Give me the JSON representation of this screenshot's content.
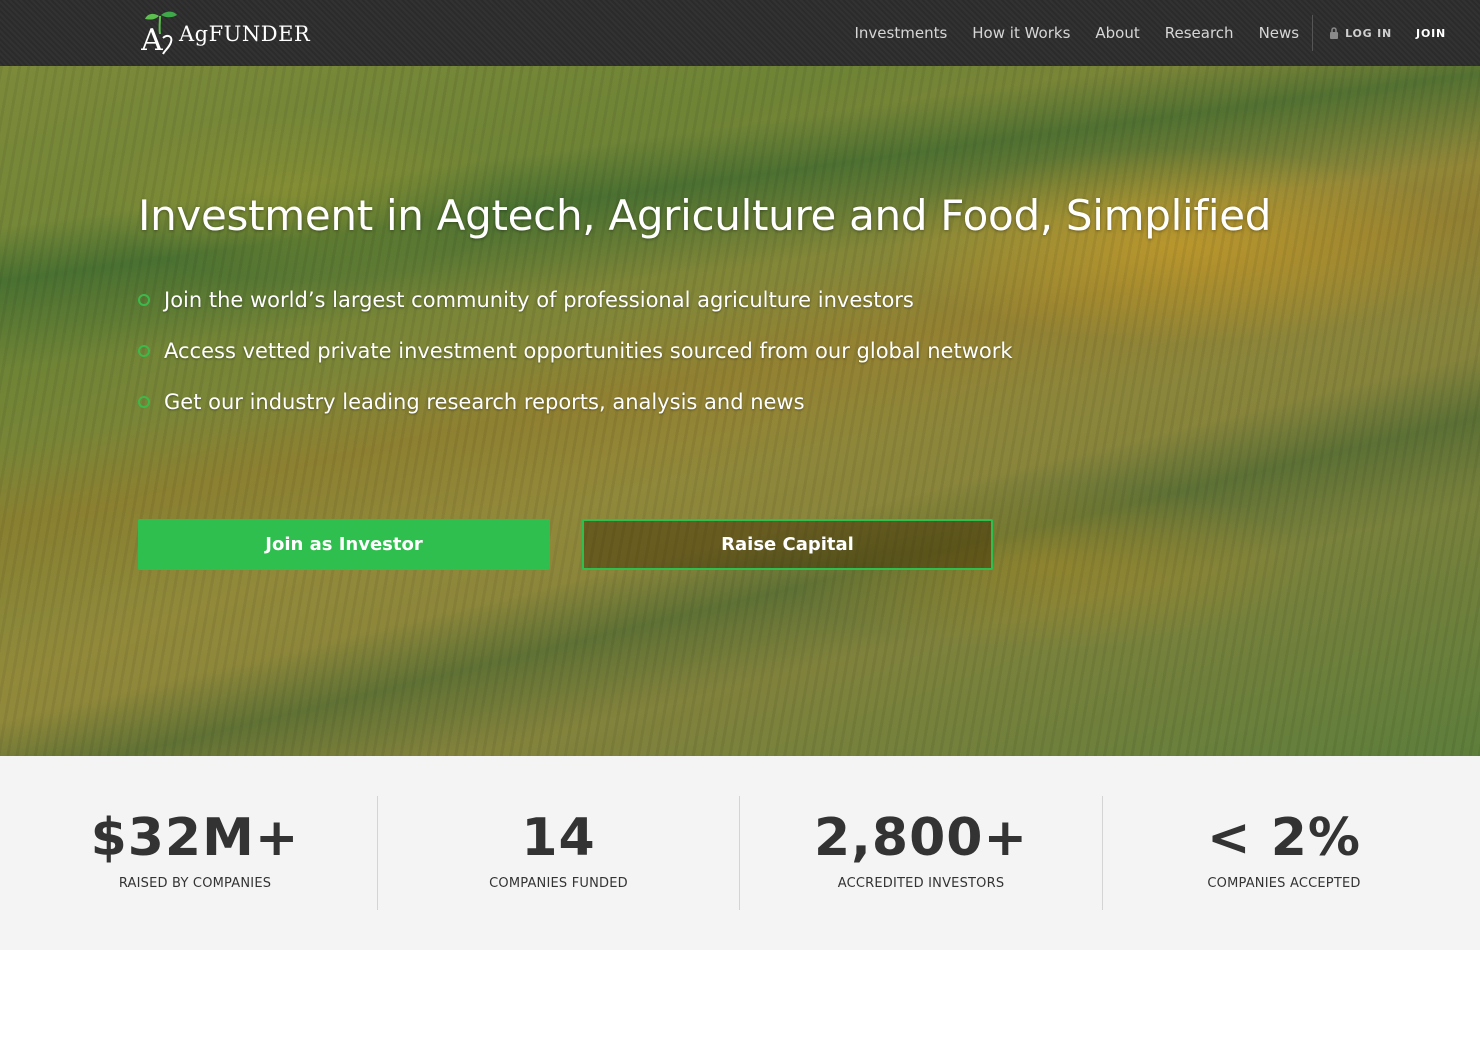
{
  "brand": {
    "logo_text": "AgFUNDER"
  },
  "nav": {
    "links": [
      "Investments",
      "How it Works",
      "About",
      "Research",
      "News"
    ],
    "login": "LOG IN",
    "join": "JOIN"
  },
  "hero": {
    "headline": "Investment in Agtech, Agriculture and Food, Simplified",
    "bullets": [
      "Join the world’s largest community of professional agriculture investors",
      "Access vetted private investment opportunities sourced from our global network",
      "Get our industry leading research reports, analysis and news"
    ],
    "buttons": {
      "investor": "Join as Investor",
      "raise": "Raise Capital"
    }
  },
  "stats": [
    {
      "value": "$32M+",
      "label": "RAISED BY COMPANIES"
    },
    {
      "value": "14",
      "label": "COMPANIES FUNDED"
    },
    {
      "value": "2,800+",
      "label": "ACCREDITED INVESTORS"
    },
    {
      "value": "< 2%",
      "label": "COMPANIES ACCEPTED"
    }
  ],
  "colors": {
    "accent": "#2fbf4e",
    "nav_bg": "#2b2b2b",
    "stats_bg": "#f4f4f4"
  }
}
